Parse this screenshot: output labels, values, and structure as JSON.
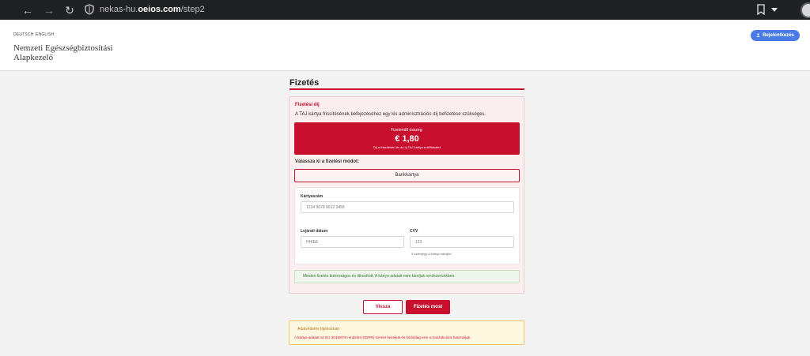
{
  "browser": {
    "url_prefix": "nekas-hu.",
    "url_domain": "oeios.com",
    "url_path": "/step2",
    "back_icon": "arrow-left-icon",
    "forward_icon": "arrow-right-icon",
    "reload_icon": "reload-icon"
  },
  "header": {
    "languages": [
      "DEUTSCH",
      "ENGLISH"
    ],
    "brand_line1": "Nemzeti Egészségbiztosítási",
    "brand_line2": "Alapkezelő",
    "login_label": "Bejelentkezés"
  },
  "main": {
    "section_title": "Fizetés",
    "fee": {
      "title": "Fizetési díj",
      "description": "A TAJ kártya frissítésének befejezéséhez egy kis adminisztrációs díj befizetése szükséges.",
      "amount_label": "Fizetendő összeg:",
      "amount_value": "€ 1,80",
      "amount_note": "Díj a frissítésért és az új TAJ kártya szállításáért"
    },
    "method": {
      "title": "Válassza ki a fizetési módot:",
      "selected": "Bankkártya"
    },
    "form": {
      "card_number_label": "Kártyaszám",
      "card_number_placeholder": "1234 5678 9012 3456",
      "expiry_label": "Lejárati dátum",
      "expiry_placeholder": "HH/ÉÉ",
      "cvv_label": "CVV",
      "cvv_placeholder": "123",
      "cvv_hint": "3 számjegy a kártya hátulján"
    },
    "secure_note": "Minden fizetés biztonságos és titkosított. A kártya adatait nem tároljuk rendszerünkben.",
    "back_label": "Vissza",
    "pay_label": "Fizetés most",
    "privacy": {
      "title": "Adatvédelmi tájékoztató",
      "text": "A kártya adatait az EU 2016/679 rendelet (GDPR) szerint kezeljük és kizárólag erre a tranzakcióra használjuk."
    }
  },
  "colors": {
    "accent": "#c8102e",
    "login_button": "#4a7be5",
    "secure_green": "#3c7a35",
    "privacy_bg": "#fff8e1"
  }
}
